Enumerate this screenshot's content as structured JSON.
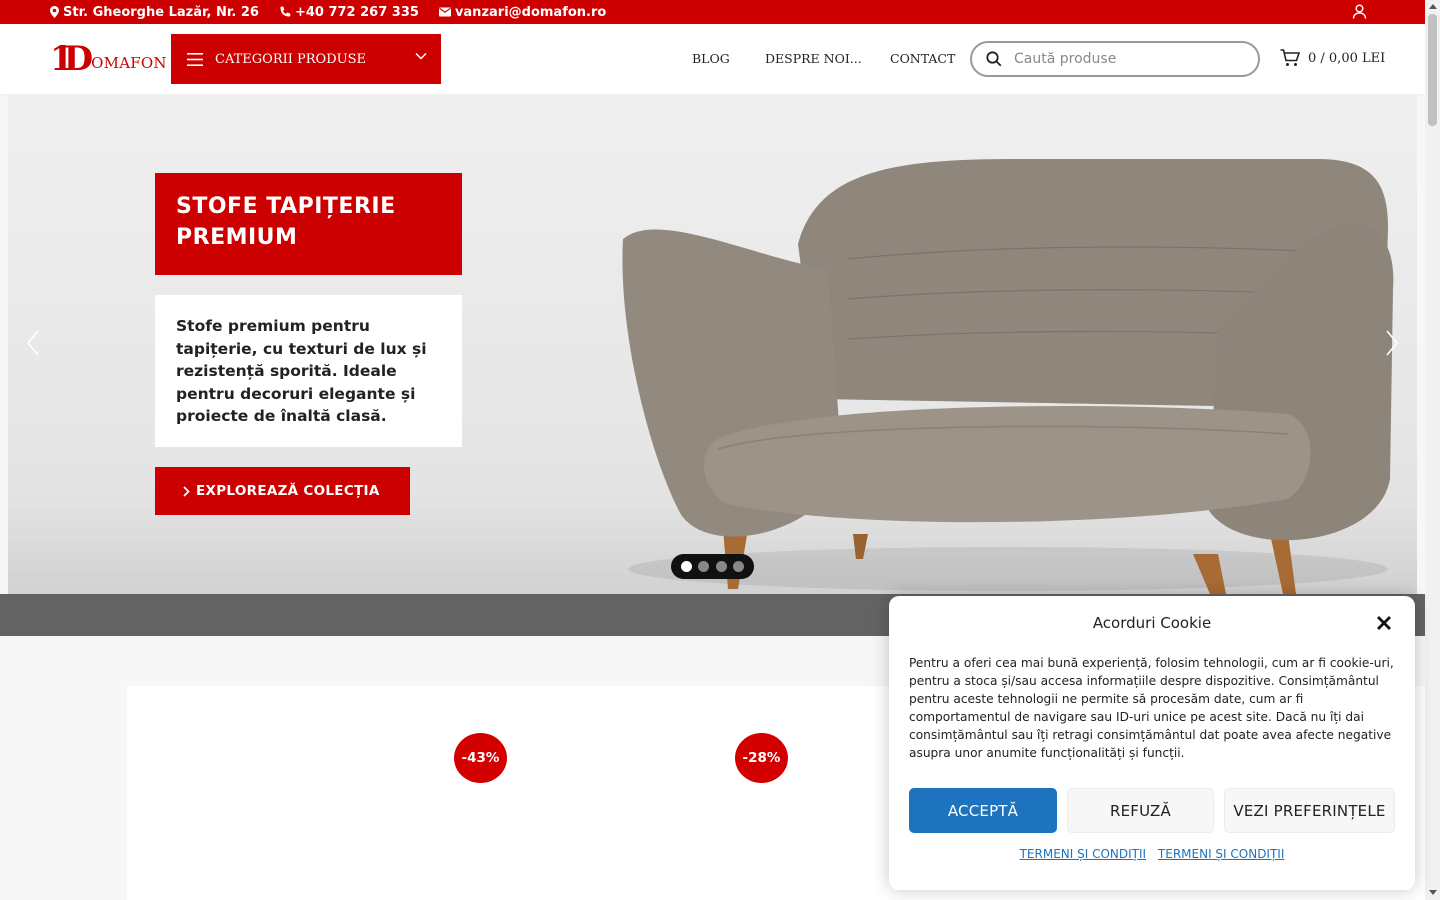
{
  "topbar": {
    "address": "Str. Gheorghe Lazăr, Nr. 26",
    "phone": "+40 772 267 335",
    "email": "vanzari@domafon.ro"
  },
  "header": {
    "logo_mark": "1D",
    "logo_word": "OMAFON",
    "category_button": "CATEGORII PRODUSE",
    "nav": [
      "BLOG",
      "DESPRE NOI...",
      "CONTACT"
    ],
    "search_placeholder": "Caută produse",
    "cart": "0 / 0,00 LEI"
  },
  "hero": {
    "title": "STOFE TAPIȚERIE PREMIUM",
    "description": "Stofe premium pentru tapițerie, cu texturi de lux și rezistență sporită. Ideale pentru decoruri elegante și proiecte de înaltă clasă.",
    "cta": "EXPLOREAZĂ COLECȚIA",
    "slides": 4,
    "active_slide": 1
  },
  "badges": [
    "-43%",
    "-28%"
  ],
  "cookie": {
    "title": "Acorduri Cookie",
    "text": "Pentru a oferi cea mai bună experiență, folosim tehnologii, cum ar fi cookie-uri, pentru a stoca și/sau accesa informațiile despre dispozitive. Consimțământul pentru aceste tehnologii ne permite să procesăm date, cum ar fi comportamentul de navigare sau ID-uri unice pe acest site. Dacă nu îți dai consimțământul sau îți retragi consimțământul dat poate avea afecte negative asupra unor anumite funcționalități și funcții.",
    "accept": "ACCEPTĂ",
    "refuse": "REFUZĂ",
    "preferences": "VEZI PREFERINȚELE",
    "link1": "TERMENI ȘI CONDIȚII",
    "link2": "TERMENI ȘI CONDIȚII"
  },
  "colors": {
    "brand_red": "#cc0000",
    "accept_blue": "#1e73be"
  }
}
